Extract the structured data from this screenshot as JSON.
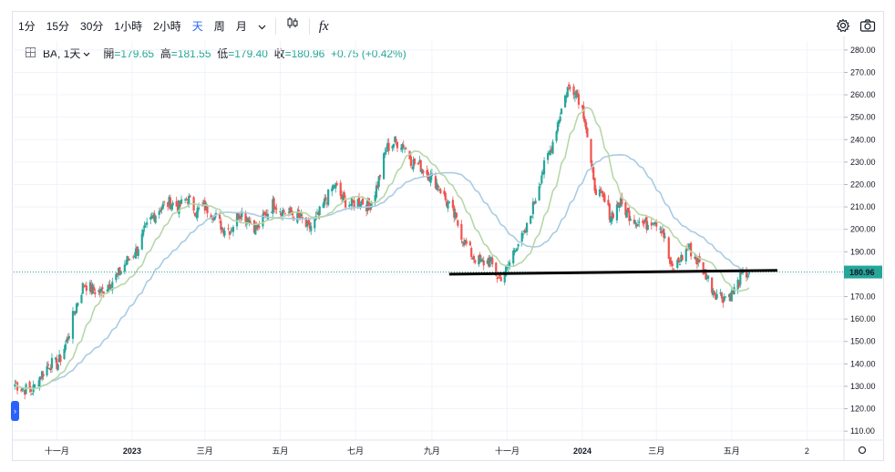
{
  "toolbar": {
    "intervals": [
      "1分",
      "15分",
      "30分",
      "1小時",
      "2小時",
      "天",
      "周",
      "月"
    ],
    "active_interval": "天",
    "indicators_glyph": "fx"
  },
  "legend": {
    "symbol": "BA",
    "interval": "1天",
    "open_label": "開",
    "open": "179.65",
    "high_label": "高",
    "high": "181.55",
    "low_label": "低",
    "low": "179.40",
    "close_label": "收",
    "close": "180.96",
    "change": "+0.75 (+0.42%)"
  },
  "price_badge": "180.96",
  "colors": {
    "up": "#26a69a",
    "down": "#ef5350",
    "ma_fast": "#b7d7a8",
    "ma_slow": "#a9cce3",
    "accent": "#2962ff",
    "trendline": "#000000"
  },
  "chart_data": {
    "type": "candlestick",
    "symbol": "BA",
    "interval": "1D",
    "y_ticks": [
      110,
      120,
      130,
      140,
      150,
      160,
      170,
      180,
      190,
      200,
      210,
      220,
      230,
      240,
      250,
      260,
      270,
      280
    ],
    "y_tick_labels": [
      "110.00",
      "120.00",
      "130.00",
      "140.00",
      "150.00",
      "160.00",
      "170.00",
      "180.00",
      "190.00",
      "200.00",
      "210.00",
      "220.00",
      "230.00",
      "240.00",
      "250.00",
      "260.00",
      "270.00",
      "280.00"
    ],
    "ylim": [
      106,
      284
    ],
    "x_ticks": [
      "十一月",
      "2023",
      "三月",
      "五月",
      "七月",
      "九月",
      "十一月",
      "2024",
      "三月",
      "五月",
      "2"
    ],
    "x_tick_dates": [
      "2022-11-01",
      "2023-01-01",
      "2023-03-01",
      "2023-05-01",
      "2023-07-01",
      "2023-09-01",
      "2023-11-01",
      "2024-01-01",
      "2024-03-01",
      "2024-05-01",
      "2024-07-01"
    ],
    "xlim": [
      "2022-09-27",
      "2024-07-31"
    ],
    "last_price": 180.96,
    "price_line": 180.96,
    "close_path": [
      [
        "2022-09-28",
        131
      ],
      [
        "2022-10-05",
        129
      ],
      [
        "2022-10-12",
        128
      ],
      [
        "2022-10-19",
        135
      ],
      [
        "2022-10-26",
        140
      ],
      [
        "2022-11-02",
        140
      ],
      [
        "2022-11-09",
        150
      ],
      [
        "2022-11-16",
        165
      ],
      [
        "2022-11-23",
        176
      ],
      [
        "2022-11-30",
        173
      ],
      [
        "2022-12-07",
        172
      ],
      [
        "2022-12-14",
        176
      ],
      [
        "2022-12-21",
        180
      ],
      [
        "2022-12-28",
        186
      ],
      [
        "2023-01-04",
        190
      ],
      [
        "2023-01-11",
        199
      ],
      [
        "2023-01-18",
        206
      ],
      [
        "2023-01-25",
        210
      ],
      [
        "2023-02-01",
        212
      ],
      [
        "2023-02-08",
        210
      ],
      [
        "2023-02-15",
        214
      ],
      [
        "2023-02-22",
        208
      ],
      [
        "2023-03-01",
        210
      ],
      [
        "2023-03-08",
        207
      ],
      [
        "2023-03-15",
        201
      ],
      [
        "2023-03-22",
        200
      ],
      [
        "2023-03-29",
        208
      ],
      [
        "2023-04-05",
        205
      ],
      [
        "2023-04-12",
        200
      ],
      [
        "2023-04-19",
        206
      ],
      [
        "2023-04-26",
        212
      ],
      [
        "2023-05-03",
        208
      ],
      [
        "2023-05-10",
        207
      ],
      [
        "2023-05-17",
        205
      ],
      [
        "2023-05-24",
        200
      ],
      [
        "2023-05-31",
        205
      ],
      [
        "2023-06-07",
        213
      ],
      [
        "2023-06-14",
        220
      ],
      [
        "2023-06-21",
        213
      ],
      [
        "2023-06-28",
        211
      ],
      [
        "2023-07-05",
        213
      ],
      [
        "2023-07-12",
        210
      ],
      [
        "2023-07-19",
        220
      ],
      [
        "2023-07-26",
        236
      ],
      [
        "2023-08-02",
        239
      ],
      [
        "2023-08-09",
        238
      ],
      [
        "2023-08-16",
        230
      ],
      [
        "2023-08-23",
        228
      ],
      [
        "2023-08-30",
        224
      ],
      [
        "2023-09-06",
        220
      ],
      [
        "2023-09-13",
        212
      ],
      [
        "2023-09-20",
        205
      ],
      [
        "2023-09-27",
        195
      ],
      [
        "2023-10-04",
        188
      ],
      [
        "2023-10-11",
        185
      ],
      [
        "2023-10-18",
        186
      ],
      [
        "2023-10-25",
        178
      ],
      [
        "2023-11-01",
        182
      ],
      [
        "2023-11-08",
        193
      ],
      [
        "2023-11-15",
        197
      ],
      [
        "2023-11-22",
        210
      ],
      [
        "2023-11-29",
        225
      ],
      [
        "2023-12-06",
        235
      ],
      [
        "2023-12-13",
        250
      ],
      [
        "2023-12-20",
        263
      ],
      [
        "2023-12-27",
        262
      ],
      [
        "2024-01-03",
        250
      ],
      [
        "2024-01-10",
        220
      ],
      [
        "2024-01-17",
        214
      ],
      [
        "2024-01-24",
        206
      ],
      [
        "2024-01-31",
        212
      ],
      [
        "2024-02-07",
        207
      ],
      [
        "2024-02-14",
        204
      ],
      [
        "2024-02-21",
        202
      ],
      [
        "2024-02-28",
        205
      ],
      [
        "2024-03-06",
        200
      ],
      [
        "2024-03-13",
        182
      ],
      [
        "2024-03-20",
        186
      ],
      [
        "2024-03-27",
        192
      ],
      [
        "2024-04-03",
        186
      ],
      [
        "2024-04-10",
        180
      ],
      [
        "2024-04-17",
        172
      ],
      [
        "2024-04-24",
        170
      ],
      [
        "2024-05-01",
        171
      ],
      [
        "2024-05-08",
        178
      ],
      [
        "2024-05-15",
        180.96
      ]
    ],
    "series": [
      {
        "type": "moving-average",
        "period_label": "",
        "role": "fast"
      },
      {
        "type": "moving-average",
        "period_label": "",
        "role": "slow"
      }
    ],
    "trendline": {
      "from": [
        "2023-09-15",
        180.0
      ],
      "to": [
        "2024-06-07",
        181.7
      ]
    },
    "grid": true,
    "title": "",
    "xlabel": "",
    "ylabel": ""
  }
}
